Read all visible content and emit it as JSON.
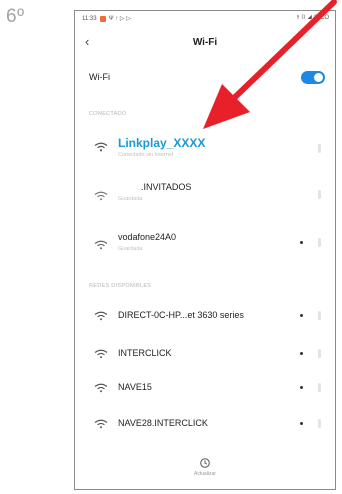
{
  "step_number": "6º",
  "status_bar": {
    "time": "11:33",
    "left_icons": "Ψ  ↑ ▷ ▷",
    "right_icons": "⫯ ▯ ◢ ◉ CO"
  },
  "nav": {
    "title": "Wi-Fi"
  },
  "wifi_toggle": {
    "label": "Wi-Fi",
    "on": true
  },
  "sections": {
    "connected_label": "CONECTADO",
    "available_label": "REDES DISPONIBLES"
  },
  "connected_networks": [
    {
      "name": "Linkplay_XXXX",
      "sub": "Conectado sin Internet"
    },
    {
      "name": ".INVITADOS",
      "sub": "Guardada"
    },
    {
      "name": "vodafone24A0",
      "sub": "Guardada"
    }
  ],
  "available_networks": [
    {
      "name": "DIRECT-0C-HP...et 3630 series"
    },
    {
      "name": "INTERCLICK"
    },
    {
      "name": "NAVE15"
    },
    {
      "name": "NAVE28.INTERCLICK"
    }
  ],
  "refresh": {
    "label": "Actualizar"
  },
  "colors": {
    "accent": "#1e88e5",
    "highlight_text": "#1a98d5",
    "arrow": "#e8202a"
  }
}
